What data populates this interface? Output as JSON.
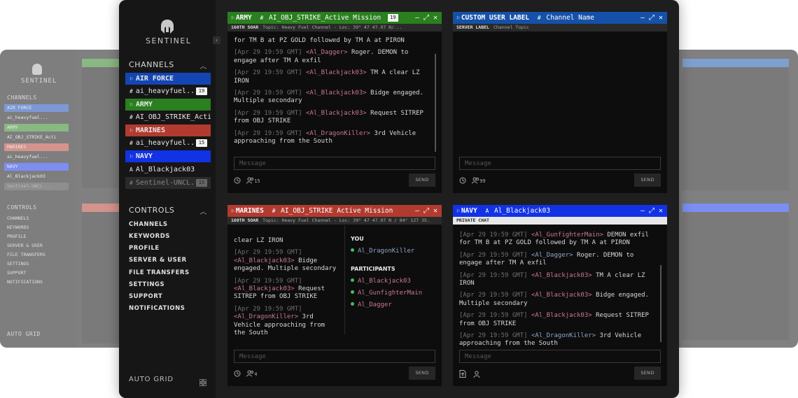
{
  "app": {
    "name": "SENTINEL"
  },
  "colors": {
    "airforce": "#1446b3",
    "army": "#2a7f1f",
    "marines": "#b23b30",
    "navy": "#1232e6",
    "custom": "#1551a8",
    "online": "#3ec15a"
  },
  "sidebar": {
    "channels_heading": "CHANNELS",
    "controls_heading": "CONTROLS",
    "channels": [
      {
        "label": "AIR FORCE",
        "type": "org"
      },
      {
        "label": "ai_heavyfuel...",
        "type": "channel",
        "badge": "19"
      },
      {
        "label": "ARMY",
        "type": "org"
      },
      {
        "label": "AI_OBJ_STRIKE_Acti",
        "type": "channel"
      },
      {
        "label": "MARINES",
        "type": "org"
      },
      {
        "label": "ai_heavyfuel...",
        "type": "channel",
        "badge": "15"
      },
      {
        "label": "NAVY",
        "type": "org"
      },
      {
        "label": "Al_Blackjack03",
        "type": "dm"
      },
      {
        "label": "Sentinel-UNCL...",
        "type": "channel",
        "badge": "15"
      }
    ],
    "controls": [
      "CHANNELS",
      "KEYWORDS",
      "PROFILE",
      "SERVER & USER",
      "FILE TRANSFERS",
      "SETTINGS",
      "SUPPORT",
      "NOTIFICATIONS"
    ],
    "auto_grid": "AUTO GRID"
  },
  "panels": {
    "army": {
      "org": "ARMY",
      "channel": "AI_OBJ_STRIKE_Active Mission",
      "badge": "19",
      "server": "160TH SOAR",
      "topic": "Topic: Heavy Fuel Channel - Loc: 39° 47 47.97 N/...",
      "messages": [
        {
          "text": "for TM B at PZ GOLD followed by TM A at PIRON",
          "partial": "exfil"
        },
        {
          "ts": "[Apr 29 19:59 GMT]",
          "nick": "<Al_Dagger>",
          "text": "Roger. DEMON to engage after TM A exfil"
        },
        {
          "ts": "[Apr 29 19:59 GMT]",
          "nick": "<Al_Blackjack03>",
          "text": "TM A clear LZ IRON"
        },
        {
          "ts": "[Apr 29 19:59 GMT]",
          "nick": "<Al_Blackjack03>",
          "text": "Bidge engaged. Multiple secondary"
        },
        {
          "ts": "[Apr 29 19:59 GMT]",
          "nick": "<Al_Blackjack03>",
          "text": "Request SITREP from OBJ STRIKE"
        },
        {
          "ts": "[Apr 29 19:59 GMT]",
          "nick": "<Al_DragonKiller>",
          "text": "3rd Vehicle approaching from the South"
        }
      ],
      "placeholder": "Message",
      "send": "SEND",
      "users": "15"
    },
    "custom": {
      "org": "CUSTOM USER LABEL",
      "channel": "Channel Name",
      "server": "SERVER LABEL",
      "topic": "Channel Topic",
      "placeholder": "Message",
      "send": "SEND",
      "users": "99"
    },
    "marines": {
      "org": "MARINES",
      "channel": "AI_OBJ_STRIKE Active Mission",
      "server": "160TH SOAR",
      "topic": "Topic: Heavy Fuel Channel - Loc: 39° 47 47.97 N / 84° 127 35.",
      "messages": [
        {
          "text": "clear LZ IRON"
        },
        {
          "ts": "[Apr 29 19:59 GMT]",
          "nick": "<Al_Blackjack03>",
          "text": "Bidge engaged. Multiple secondary"
        },
        {
          "ts": "[Apr 29 19:59 GMT]",
          "nick": "<Al_Blackjack03>",
          "text": "Request SITREP from OBJ STRIKE"
        },
        {
          "ts": "[Apr 29 19:59 GMT]",
          "nick": "<Al_DragonKiller>",
          "text": "3rd Vehicle approaching from the South"
        }
      ],
      "you_heading": "YOU",
      "you": "Al_DragonKiller",
      "participants_heading": "PARTICIPANTS",
      "participants": [
        "Al_Blackjack03",
        "Al_GunfighterMain",
        "Al_Dagger"
      ],
      "placeholder": "Message",
      "send": "SEND",
      "users": "4"
    },
    "navy": {
      "org": "NAVY",
      "channel": "Al_Blackjack03",
      "server": "PRIVATE CHAT",
      "messages": [
        {
          "ts": "[Apr 29 19:59 GMT]",
          "nick": "<Al_GunfighterMain>",
          "text": "DEMON exfil for TM B at PZ GOLD followed by TM A at PIRON"
        },
        {
          "ts": "[Apr 29 19:59 GMT]",
          "nick": "<Al_Dagger>",
          "text": "Roger. DEMON to engage after TM A exfil"
        },
        {
          "ts": "[Apr 29 19:59 GMT]",
          "nick": "<Al_Blackjack03>",
          "text": "TM A clear LZ IRON"
        },
        {
          "ts": "[Apr 29 19:59 GMT]",
          "nick": "<Al_Blackjack03>",
          "text": "Bidge engaged. Multiple secondary"
        },
        {
          "ts": "[Apr 29 19:59 GMT]",
          "nick": "<Al_Blackjack03>",
          "text": "Request SITREP from OBJ STRIKE"
        },
        {
          "ts": "[Apr 29 19:59 GMT]",
          "nick": "<Al_DragonKiller>",
          "text": "3rd Vehicle approaching from the South"
        }
      ],
      "placeholder": "Message",
      "send": "SEND"
    }
  }
}
